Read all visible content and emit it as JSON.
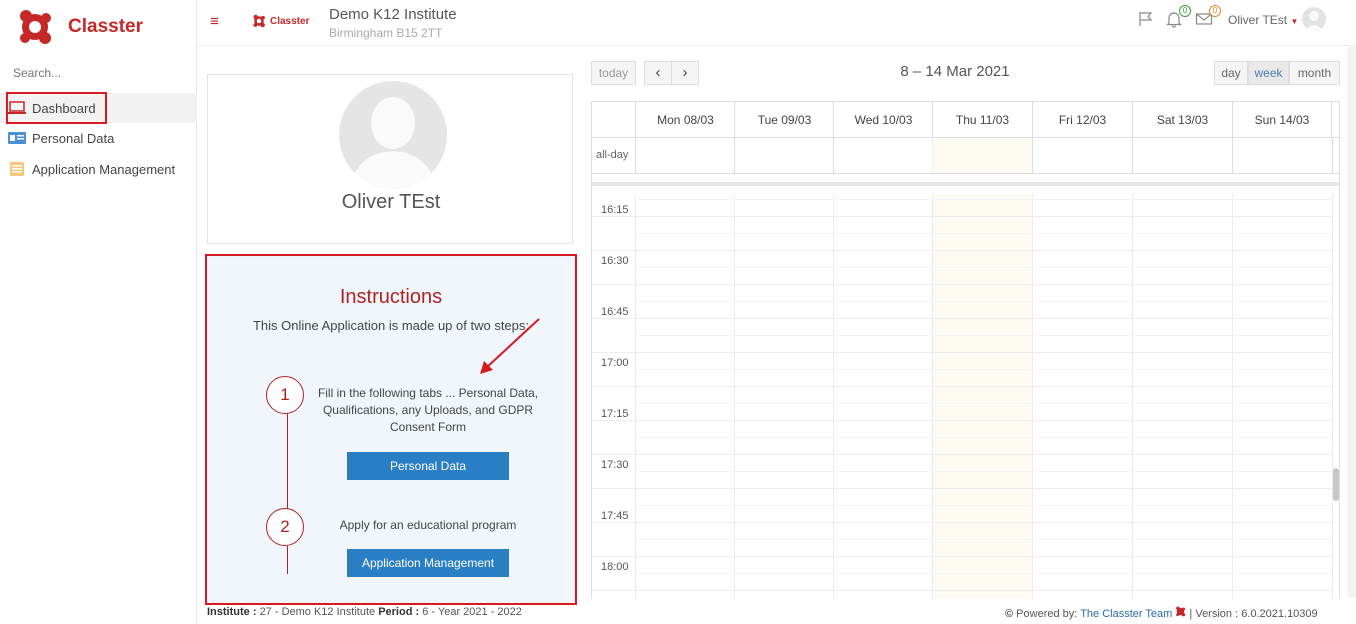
{
  "brand": {
    "name": "Classter",
    "small_name": "Classter"
  },
  "sidebar": {
    "search_placeholder": "Search...",
    "items": [
      {
        "label": "Dashboard",
        "icon": "laptop-icon"
      },
      {
        "label": "Personal Data",
        "icon": "id-card-icon"
      },
      {
        "label": "Application Management",
        "icon": "form-icon"
      }
    ]
  },
  "header": {
    "institute": "Demo K12 Institute",
    "address": "Birmingham B15 2TT",
    "notifications_count": "0",
    "messages_count": "0",
    "user_name": "Oliver TEst"
  },
  "profile": {
    "name": "Oliver TEst"
  },
  "instructions": {
    "title": "Instructions",
    "subtitle": "This Online Application is made up of two steps:",
    "steps": [
      {
        "number": "1",
        "text": "Fill in the following tabs ...  Personal Data, Qualifications, any Uploads, and GDPR Consent  Form",
        "button": "Personal Data"
      },
      {
        "number": "2",
        "text": "Apply for an educational program",
        "button": "Application Management"
      }
    ]
  },
  "calendar": {
    "today_label": "today",
    "prev_label": "‹",
    "next_label": "›",
    "range_title": "8 – 14 Mar 2021",
    "views": [
      "day",
      "week",
      "month"
    ],
    "active_view": "week",
    "days": [
      "Mon 08/03",
      "Tue 09/03",
      "Wed 10/03",
      "Thu 11/03",
      "Fri 12/03",
      "Sat 13/03",
      "Sun 14/03"
    ],
    "allday_label": "all-day",
    "times": [
      "16:15",
      "16:30",
      "16:45",
      "17:00",
      "17:15",
      "17:30",
      "17:45",
      "18:00"
    ]
  },
  "footer": {
    "institute_label": "Institute :",
    "institute_value": "27 - Demo K12 Institute",
    "period_label": "Period :",
    "period_value": "6 - Year 2021 - 2022",
    "powered_label": "Powered by:",
    "powered_link": "The Classter Team",
    "version": "| Version : 6.0.2021.10309"
  },
  "colors": {
    "brand_red": "#c62828",
    "button_blue": "#2a7fc4",
    "annotation_red": "#d71920"
  }
}
